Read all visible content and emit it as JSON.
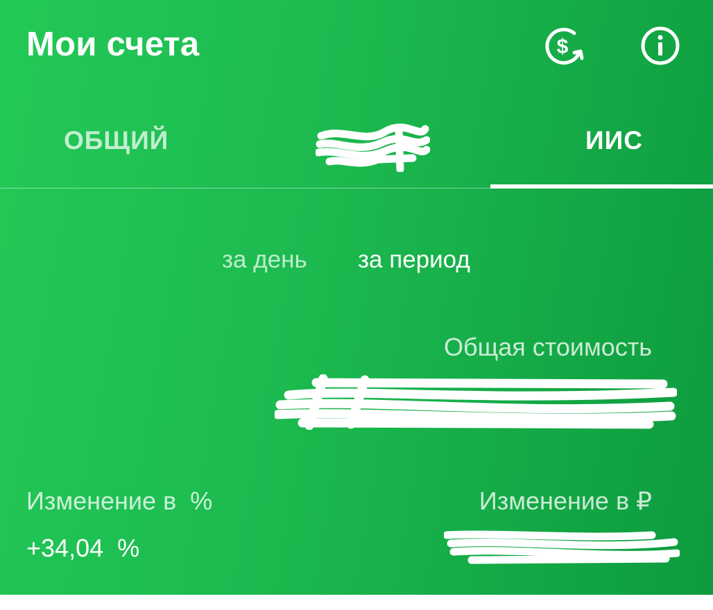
{
  "header": {
    "title": "Мои счета",
    "currency_icon": "dollar-refresh-icon",
    "info_icon": "info-icon"
  },
  "tabs": [
    {
      "label": "ОБЩИЙ",
      "selected": false
    },
    {
      "label": "",
      "selected": false,
      "redacted": true
    },
    {
      "label": "ИИС",
      "selected": true
    }
  ],
  "period": {
    "day_label": "за день",
    "range_label": "за период",
    "selected": "за период"
  },
  "total": {
    "label": "Общая стоимость",
    "value": ""
  },
  "change_percent": {
    "label": "Изменение в  %",
    "value": "+34,04  %"
  },
  "change_rub": {
    "label": "Изменение в ₽",
    "value": ""
  },
  "colors": {
    "background_start": "#23c957",
    "background_end": "#0d9b3e",
    "text": "#ffffff"
  }
}
